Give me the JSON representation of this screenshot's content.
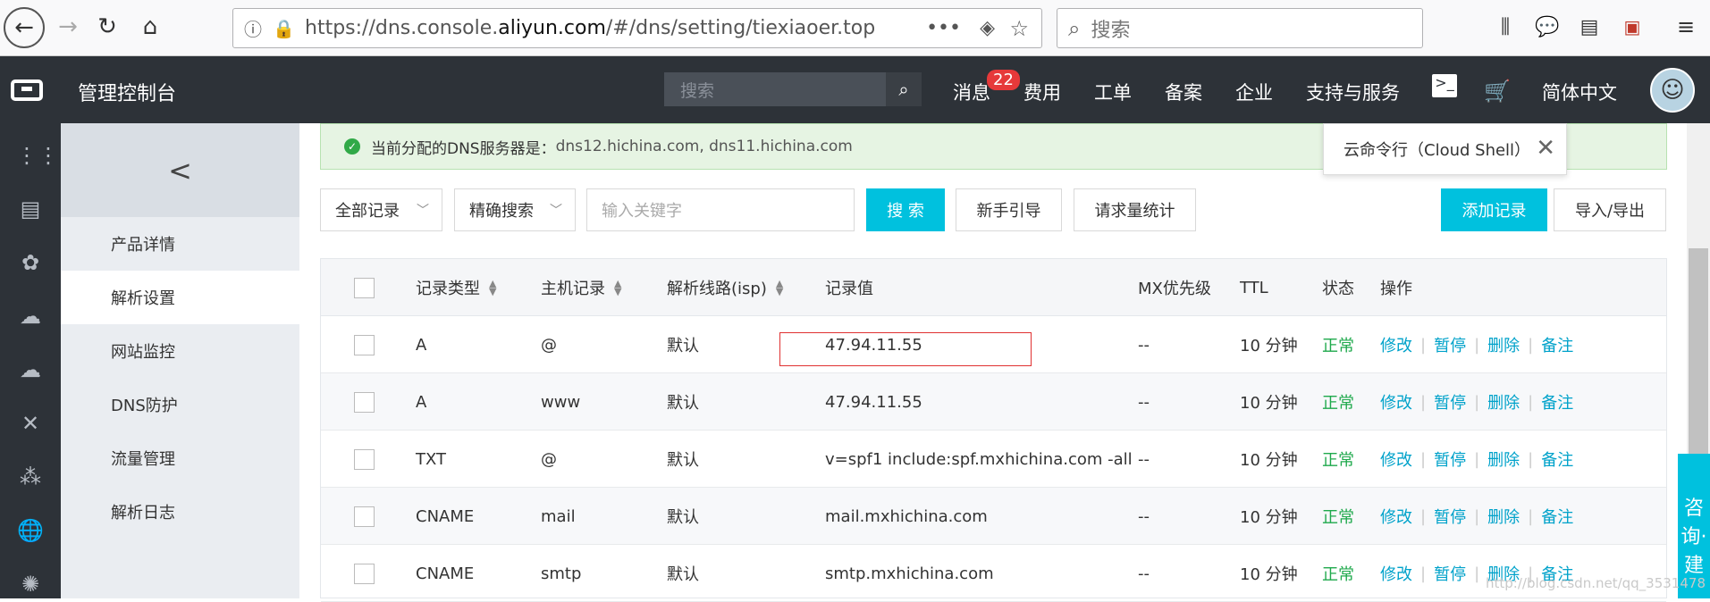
{
  "browser": {
    "url_prefix": "https://dns.console.",
    "url_domain": "aliyun.com",
    "url_suffix": "/#/dns/setting/tiexiaoer.top",
    "search_placeholder": "搜索"
  },
  "topbar": {
    "title": "管理控制台",
    "search_placeholder": "搜索",
    "nav": [
      "消息",
      "费用",
      "工单",
      "备案",
      "企业",
      "支持与服务",
      "简体中文"
    ],
    "badge": "22"
  },
  "subnav": {
    "items": [
      "产品详情",
      "解析设置",
      "网站监控",
      "DNS防护",
      "流量管理",
      "解析日志"
    ],
    "active": "解析设置"
  },
  "notice": {
    "label": "当前分配的DNS服务器是：",
    "servers": "dns12.hichina.com, dns11.hichina.com"
  },
  "tooltip": {
    "text": "云命令行（Cloud Shell）"
  },
  "toolbar": {
    "filter_all": "全部记录",
    "filter_match": "精确搜索",
    "keyword_placeholder": "输入关键字",
    "search_btn": "搜 索",
    "guide_btn": "新手引导",
    "stats_btn": "请求量统计",
    "add_btn": "添加记录",
    "import_btn": "导入/导出"
  },
  "table": {
    "headers": [
      "记录类型",
      "主机记录",
      "解析线路(isp)",
      "记录值",
      "MX优先级",
      "TTL",
      "状态",
      "操作"
    ],
    "actions": [
      "修改",
      "暂停",
      "删除",
      "备注"
    ],
    "rows": [
      {
        "type": "A",
        "host": "@",
        "line": "默认",
        "value": "47.94.11.55",
        "mx": "--",
        "ttl": "10 分钟",
        "status": "正常"
      },
      {
        "type": "A",
        "host": "www",
        "line": "默认",
        "value": "47.94.11.55",
        "mx": "--",
        "ttl": "10 分钟",
        "status": "正常"
      },
      {
        "type": "TXT",
        "host": "@",
        "line": "默认",
        "value": "v=spf1 include:spf.mxhichina.com -all",
        "mx": "--",
        "ttl": "10 分钟",
        "status": "正常"
      },
      {
        "type": "CNAME",
        "host": "mail",
        "line": "默认",
        "value": "mail.mxhichina.com",
        "mx": "--",
        "ttl": "10 分钟",
        "status": "正常"
      },
      {
        "type": "CNAME",
        "host": "smtp",
        "line": "默认",
        "value": "smtp.mxhichina.com",
        "mx": "--",
        "ttl": "10 分钟",
        "status": "正常"
      }
    ]
  },
  "consult": {
    "text": "咨询·建"
  },
  "watermark": "http://blog.csdn.net/qq_3531478"
}
